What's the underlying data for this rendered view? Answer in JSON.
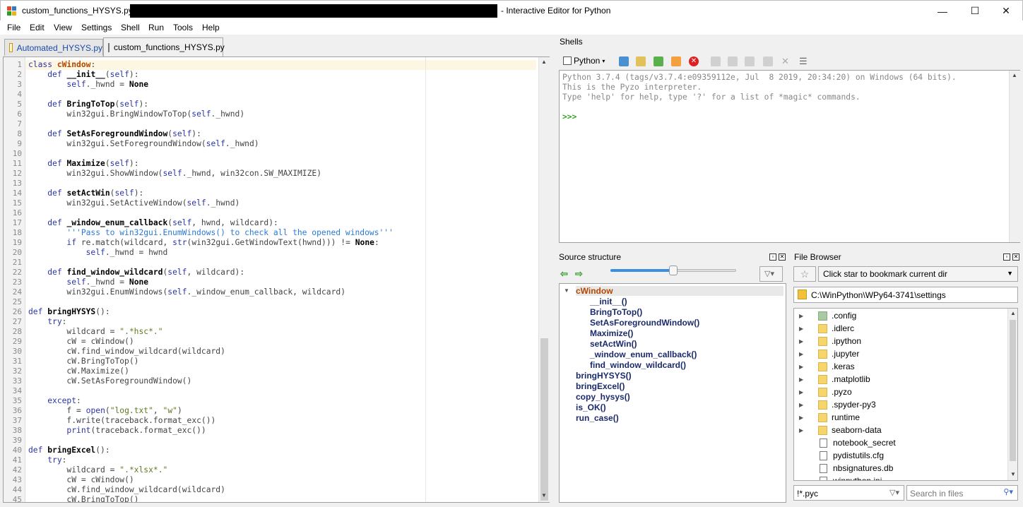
{
  "window": {
    "file_name": "custom_functions_HYSYS.py",
    "app_title": "- Interactive Editor for Python",
    "minimize": "—",
    "maximize": "☐",
    "close": "✕"
  },
  "menu": [
    "File",
    "Edit",
    "View",
    "Settings",
    "Shell",
    "Run",
    "Tools",
    "Help"
  ],
  "editor_tabs": [
    {
      "label": "Automated_HYSYS.py",
      "active": false
    },
    {
      "label": "custom_functions_HYSYS.py",
      "active": true
    }
  ],
  "code_lines": [
    "class cWindow:",
    "    def __init__(self):",
    "        self._hwnd = None",
    "",
    "    def BringToTop(self):",
    "        win32gui.BringWindowToTop(self._hwnd)",
    "",
    "    def SetAsForegroundWindow(self):",
    "        win32gui.SetForegroundWindow(self._hwnd)",
    "",
    "    def Maximize(self):",
    "        win32gui.ShowWindow(self._hwnd, win32con.SW_MAXIMIZE)",
    "",
    "    def setActWin(self):",
    "        win32gui.SetActiveWindow(self._hwnd)",
    "",
    "    def _window_enum_callback(self, hwnd, wildcard):",
    "        '''Pass to win32gui.EnumWindows() to check all the opened windows'''",
    "        if re.match(wildcard, str(win32gui.GetWindowText(hwnd))) != None:",
    "            self._hwnd = hwnd",
    "",
    "    def find_window_wildcard(self, wildcard):",
    "        self._hwnd = None",
    "        win32gui.EnumWindows(self._window_enum_callback, wildcard)",
    "",
    "def bringHYSYS():",
    "    try:",
    "        wildcard = \".*hsc*.\"",
    "        cW = cWindow()",
    "        cW.find_window_wildcard(wildcard)",
    "        cW.BringToTop()",
    "        cW.Maximize()",
    "        cW.SetAsForegroundWindow()",
    "",
    "    except:",
    "        f = open(\"log.txt\", \"w\")",
    "        f.write(traceback.format_exc())",
    "        print(traceback.format_exc())",
    "",
    "def bringExcel():",
    "    try:",
    "        wildcard = \".*xlsx*.\"",
    "        cW = cWindow()",
    "        cW.find_window_wildcard(wildcard)",
    "        cW.BringToTop()"
  ],
  "shells": {
    "label": "Shells",
    "shell_tab": "Python",
    "output": "Python 3.7.4 (tags/v3.7.4:e09359112e, Jul  8 2019, 20:34:20) on Windows (64 bits).\nThis is the Pyzo interpreter.\nType 'help' for help, type '?' for a list of *magic* commands.",
    "prompt": ">>>"
  },
  "source_structure": {
    "label": "Source structure",
    "tree": [
      {
        "label": "cWindow",
        "depth": 0,
        "kind": "class",
        "expanded": true
      },
      {
        "label": "__init__()",
        "depth": 1
      },
      {
        "label": "BringToTop()",
        "depth": 1
      },
      {
        "label": "SetAsForegroundWindow()",
        "depth": 1
      },
      {
        "label": "Maximize()",
        "depth": 1
      },
      {
        "label": "setActWin()",
        "depth": 1
      },
      {
        "label": "_window_enum_callback()",
        "depth": 1
      },
      {
        "label": "find_window_wildcard()",
        "depth": 1
      },
      {
        "label": "bringHYSYS()",
        "depth": 0
      },
      {
        "label": "bringExcel()",
        "depth": 0
      },
      {
        "label": "copy_hysys()",
        "depth": 0
      },
      {
        "label": "is_OK()",
        "depth": 0
      },
      {
        "label": "run_case()",
        "depth": 0
      }
    ],
    "slider_level": 0.5
  },
  "file_browser": {
    "label": "File Browser",
    "bookmark_combo": "Click star to bookmark current dir",
    "path": "C:\\WinPython\\WPy64-3741\\settings",
    "entries": [
      {
        "name": ".config",
        "type": "folder",
        "special": true
      },
      {
        "name": ".idlerc",
        "type": "folder"
      },
      {
        "name": ".ipython",
        "type": "folder"
      },
      {
        "name": ".jupyter",
        "type": "folder"
      },
      {
        "name": ".keras",
        "type": "folder"
      },
      {
        "name": ".matplotlib",
        "type": "folder"
      },
      {
        "name": ".pyzo",
        "type": "folder"
      },
      {
        "name": ".spyder-py3",
        "type": "folder"
      },
      {
        "name": "runtime",
        "type": "folder"
      },
      {
        "name": "seaborn-data",
        "type": "folder"
      },
      {
        "name": "notebook_secret",
        "type": "file"
      },
      {
        "name": "pydistutils.cfg",
        "type": "file"
      },
      {
        "name": "nbsignatures.db",
        "type": "file"
      },
      {
        "name": "winpython.ini",
        "type": "file"
      }
    ],
    "filter": "!*.pyc",
    "search_placeholder": "Search in files"
  },
  "colors": {
    "accent": "#3c8ee0",
    "class_name": "#b34700",
    "tree_text": "#1a2a6a",
    "prompt": "#2aa020"
  }
}
